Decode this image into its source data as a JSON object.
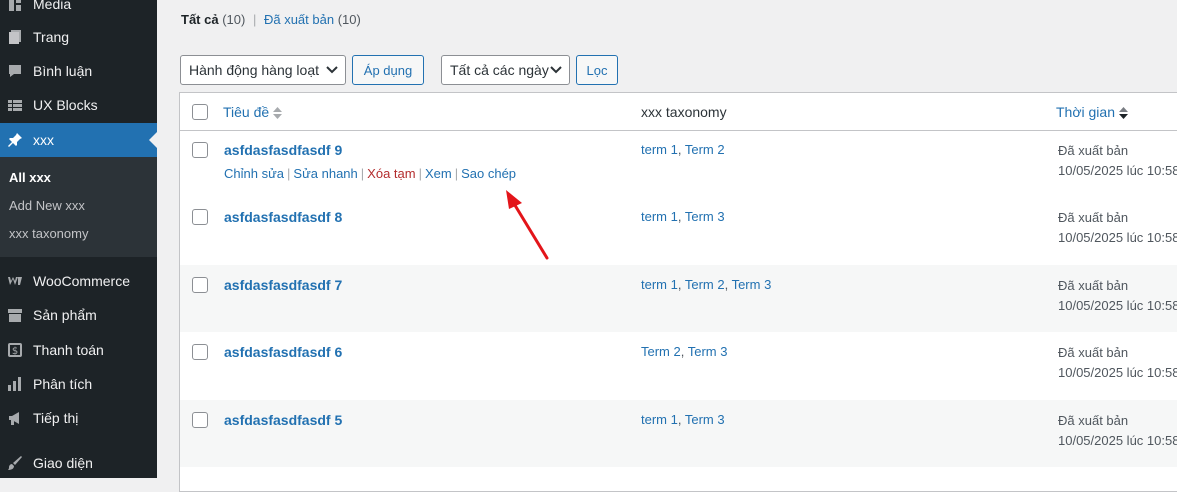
{
  "sidebar": {
    "items": [
      {
        "label": "Media",
        "icon": "media-icon"
      },
      {
        "label": "Trang",
        "icon": "page-icon"
      },
      {
        "label": "Bình luận",
        "icon": "comment-icon"
      },
      {
        "label": "UX Blocks",
        "icon": "blocks-icon"
      },
      {
        "label": "xxx",
        "icon": "pin-icon",
        "active": true
      },
      {
        "label": "WooCommerce",
        "icon": "woocommerce-icon"
      },
      {
        "label": "Sản phẩm",
        "icon": "archive-icon"
      },
      {
        "label": "Thanh toán",
        "icon": "payment-icon"
      },
      {
        "label": "Phân tích",
        "icon": "chart-icon"
      },
      {
        "label": "Tiếp thị",
        "icon": "megaphone-icon"
      },
      {
        "label": "Giao diện",
        "icon": "brush-icon"
      }
    ],
    "submenu": [
      "All xxx",
      "Add New xxx",
      "xxx taxonomy"
    ]
  },
  "filters": {
    "all_label": "Tất cả",
    "all_count": "(10)",
    "published_label": "Đã xuất bản",
    "published_count": "(10)",
    "separator": "|"
  },
  "toolbar": {
    "bulk_action": "Hành động hàng loạt",
    "apply": "Áp dụng",
    "all_dates": "Tất cả các ngày",
    "filter": "Lọc"
  },
  "table": {
    "columns": {
      "title": "Tiêu đề",
      "taxonomy": "xxx taxonomy",
      "date": "Thời gian"
    },
    "row_actions": {
      "edit": "Chỉnh sửa",
      "quick_edit": "Sửa nhanh",
      "trash": "Xóa tạm",
      "view": "Xem",
      "duplicate": "Sao chép",
      "sep": "|"
    },
    "rows": [
      {
        "title": "asfdasfasdfasdf 9",
        "terms": [
          "term 1",
          "Term 2"
        ],
        "status": "Đã xuất bản",
        "date": "10/05/2025 lúc 10:58"
      },
      {
        "title": "asfdasfasdfasdf 8",
        "terms": [
          "term 1",
          "Term 3"
        ],
        "status": "Đã xuất bản",
        "date": "10/05/2025 lúc 10:58"
      },
      {
        "title": "asfdasfasdfasdf 7",
        "terms": [
          "term 1",
          "Term 2",
          "Term 3"
        ],
        "status": "Đã xuất bản",
        "date": "10/05/2025 lúc 10:58"
      },
      {
        "title": "asfdasfasdfasdf 6",
        "terms": [
          "Term 2",
          "Term 3"
        ],
        "status": "Đã xuất bản",
        "date": "10/05/2025 lúc 10:58"
      },
      {
        "title": "asfdasfasdfasdf 5",
        "terms": [
          "term 1",
          "Term 3"
        ],
        "status": "Đã xuất bản",
        "date": "10/05/2025 lúc 10:58"
      }
    ]
  },
  "annotation": {
    "color": "#e3151a"
  }
}
